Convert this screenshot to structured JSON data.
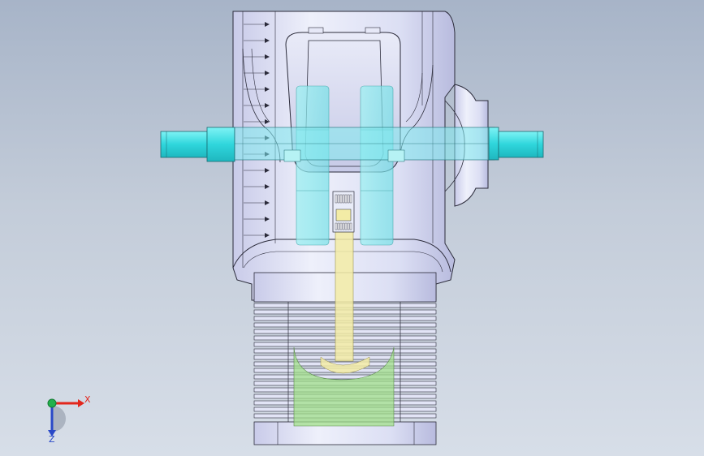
{
  "viewport": {
    "background_top": "#a7b4c8",
    "background_bottom": "#d7dee8"
  },
  "triad": {
    "x_label": "X",
    "z_label": "Z",
    "x_color": "#e2261c",
    "y_color": "#22b14c",
    "z_color": "#2a49c8"
  },
  "colors": {
    "body_metal": "#d9dcf3",
    "shaft": "#3ee0e6",
    "connecting_rod": "#f2eaa2",
    "piston": "#a9e38d"
  }
}
